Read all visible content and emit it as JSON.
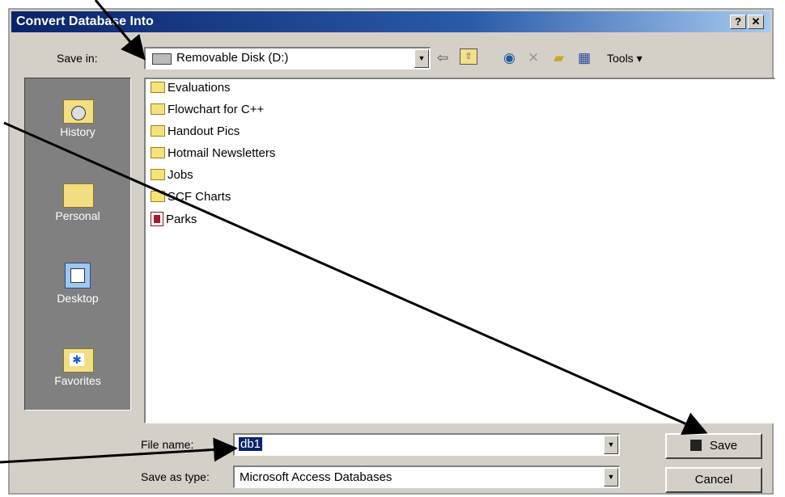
{
  "window": {
    "title": "Convert Database Into",
    "help_btn": "?",
    "close_btn": "✕"
  },
  "save_in": {
    "label": "Save in:",
    "value": "Removable Disk (D:)"
  },
  "toolbar": {
    "tools_label": "Tools ▾"
  },
  "places": [
    {
      "label": "History",
      "icon": "history-icon"
    },
    {
      "label": "Personal",
      "icon": "personal-folder-icon"
    },
    {
      "label": "Desktop",
      "icon": "desktop-icon"
    },
    {
      "label": "Favorites",
      "icon": "favorites-icon"
    }
  ],
  "files": [
    {
      "name": "Evaluations",
      "type": "folder"
    },
    {
      "name": "Flowchart for C++",
      "type": "folder"
    },
    {
      "name": "Handout Pics",
      "type": "folder"
    },
    {
      "name": "Hotmail Newsletters",
      "type": "folder"
    },
    {
      "name": "Jobs",
      "type": "folder"
    },
    {
      "name": "SCF Charts",
      "type": "folder"
    },
    {
      "name": "Parks",
      "type": "access-database"
    }
  ],
  "file_name": {
    "label": "File name:",
    "value": "db1"
  },
  "save_as_type": {
    "label": "Save as type:",
    "value": "Microsoft Access Databases"
  },
  "buttons": {
    "save": "Save",
    "cancel": "Cancel"
  },
  "colors": {
    "title_bar": "#0a246a",
    "dialog": "#d4d0c8",
    "places_bar": "#808080",
    "selection": "#0a246a"
  }
}
